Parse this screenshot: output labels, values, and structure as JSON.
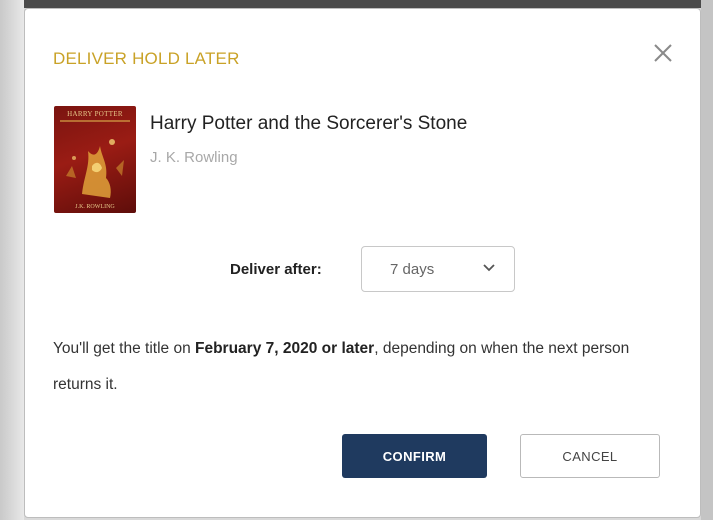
{
  "dialog": {
    "title": "DELIVER HOLD LATER",
    "close_icon": "close-icon",
    "title_color": "#c9a227"
  },
  "book": {
    "title": "Harry Potter and the Sorcerer's Stone",
    "author": "J. K. Rowling",
    "cover": {
      "title_text": "HARRY POTTER",
      "author_text": "J.K. ROWLING",
      "background_color": "#8b1a12"
    }
  },
  "delivery": {
    "label": "Deliver after:",
    "selected_value": "7 days",
    "dropdown_icon": "chevron-down-icon"
  },
  "info": {
    "prefix": "You'll get the title on ",
    "date_bold": "February 7, 2020 or later",
    "suffix": ", depending on when the next person returns it."
  },
  "actions": {
    "confirm_label": "CONFIRM",
    "cancel_label": "CANCEL",
    "confirm_color": "#1f3a5f"
  }
}
